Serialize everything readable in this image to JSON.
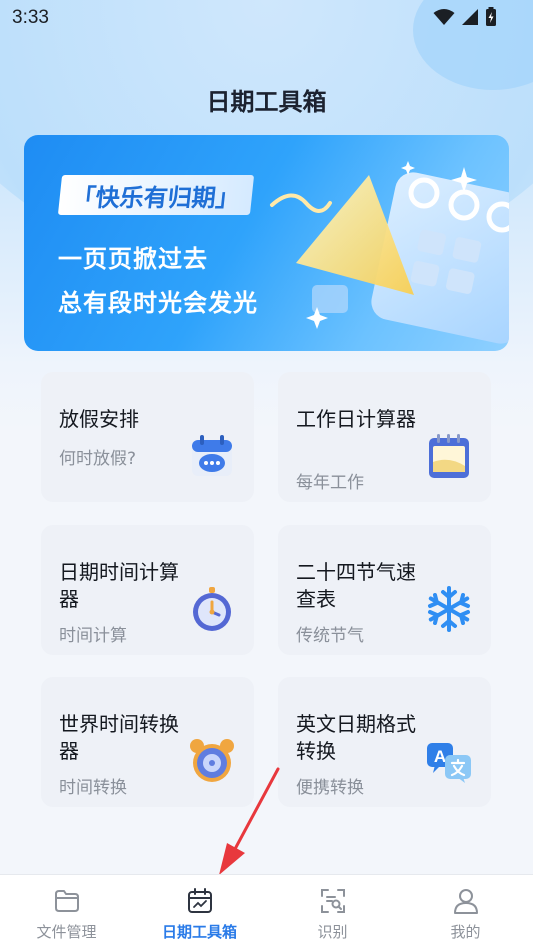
{
  "status_bar": {
    "time": "3:33"
  },
  "header": {
    "title": "日期工具箱"
  },
  "banner": {
    "tag": "「快乐有归期」",
    "line1": "一页页掀过去",
    "line2": "总有段时光会发光"
  },
  "tools": [
    {
      "title": "放假安排",
      "subtitle": "何时放假?",
      "icon": "calendar-chat-icon"
    },
    {
      "title": "工作日计算器",
      "subtitle": "每年工作",
      "icon": "calendar-note-icon"
    },
    {
      "title": "日期时间计算器",
      "subtitle": "时间计算",
      "icon": "stopwatch-icon"
    },
    {
      "title": "二十四节气速查表",
      "subtitle": "传统节气",
      "icon": "snowflake-icon"
    },
    {
      "title": "世界时间转换器",
      "subtitle": "时间转换",
      "icon": "alarm-clock-icon"
    },
    {
      "title": "英文日期格式转换",
      "subtitle": "便携转换",
      "icon": "translate-icon"
    }
  ],
  "tab_bar": {
    "tabs": [
      {
        "label": "文件管理",
        "icon": "folder-icon",
        "active": false
      },
      {
        "label": "日期工具箱",
        "icon": "calendar-tool-icon",
        "active": true
      },
      {
        "label": "识别",
        "icon": "scan-icon",
        "active": false
      },
      {
        "label": "我的",
        "icon": "person-icon",
        "active": false
      }
    ]
  },
  "colors": {
    "accent": "#2a7be8",
    "annotation_arrow": "#e8383d"
  }
}
